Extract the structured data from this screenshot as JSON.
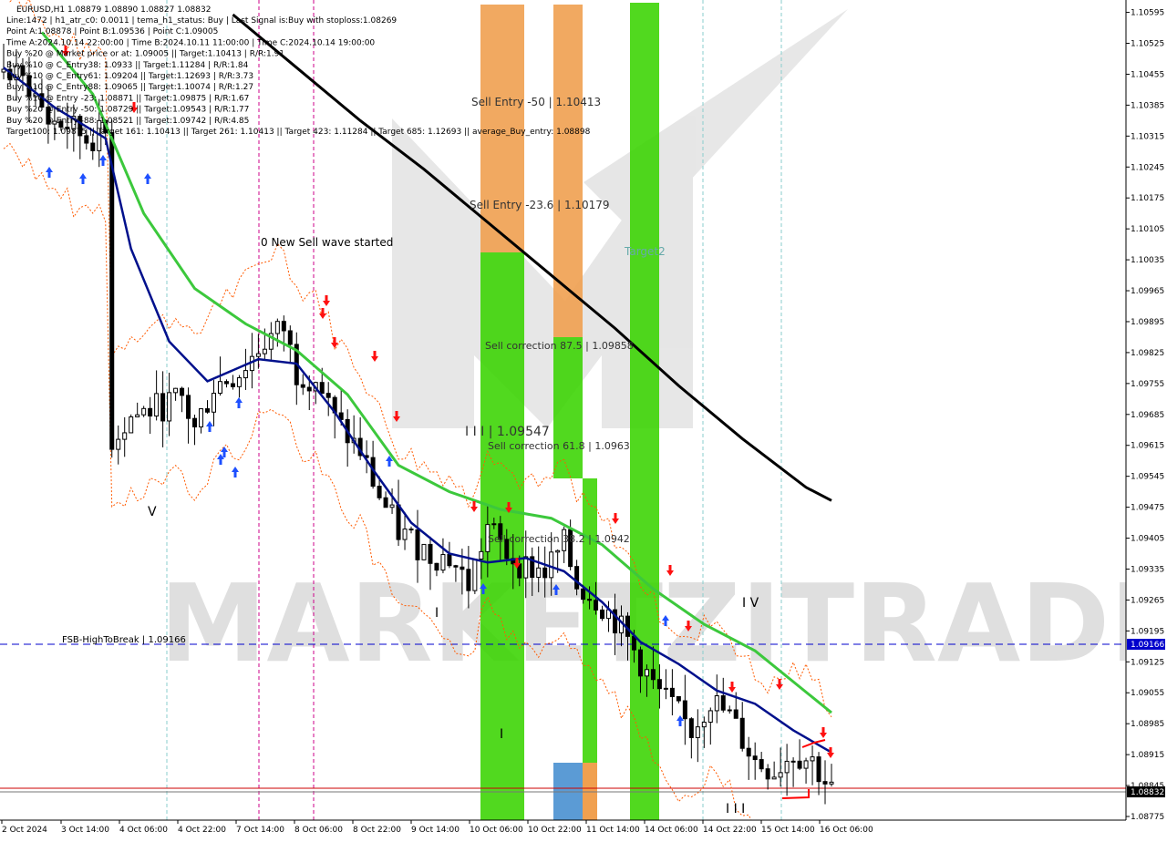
{
  "header": {
    "symbol_line": "EURUSD,H1  1.08879 1.08890 1.08827 1.08832",
    "info_lines": [
      "Line:1472 | h1_atr_c0: 0.0011 | tema_h1_status: Buy | Last Signal is:Buy with stoploss:1.08269",
      "Point A:1.08878 | Point B:1.09536 | Point C:1.09005",
      "Time A:2024.10.14 22:00:00 | Time B:2024.10.11 11:00:00 | Time C:2024.10.14 19:00:00",
      "Buy %20 @ Market price or at: 1.09005 || Target:1.10413 | R/R:1.91",
      "Buy %10 @ C_Entry38: 1.0933 || Target:1.11284 | R/R:1.84",
      "Buy %10 @ C_Entry61: 1.09204 || Target:1.12693 | R/R:3.73",
      "Buy %10 @ C_Entry88: 1.09065 || Target:1.10074 | R/R:1.27",
      "Buy %10 @ Entry -23: 1.08871 || Target:1.09875 | R/R:1.67",
      "Buy %20 @ Entry -50: 1.08729 || Target:1.09543 | R/R:1.77",
      "Buy %20 @ Entry -88: 1.08521 || Target:1.09742 | R/R:4.85",
      "Target100: 1.09875 || Target 161: 1.10413 || Target 261: 1.10413 || Target 423: 1.11284 || Target 685: 1.12693 || average_Buy_entry: 1.08898"
    ]
  },
  "annotations": {
    "sell_entry_50": "Sell Entry -50 | 1.10413",
    "sell_entry_23": "Sell Entry -23.6 | 1.10179",
    "new_sell_wave": "0 New Sell wave started",
    "target2": "Target2",
    "sell_corr_875": "Sell correction 87.5 | 1.09858",
    "sell_corr_618": "Sell correction 61.8 | 1.0963",
    "sell_corr_382": "Sell correction 38.2 | 1.0942",
    "wave_iii_label": "I I I | 1.09547",
    "fsb_label": "FSB-HighToBreak | 1.09166",
    "wave_v": "V",
    "wave_i_a": "I",
    "wave_i_b": "I",
    "wave_iv": "I V",
    "wave_iii_bottom": "I I I",
    "watermark": "MARKETZITRADE"
  },
  "price_tags": {
    "fsb": "1.09166",
    "current": "1.08832"
  },
  "colors": {
    "fsb_line": "#0000cc",
    "current_line": "#cc0000",
    "green_zone": "#39d400",
    "orange_zone": "#f0a050",
    "blue_zone": "#5b9bd5",
    "ema_green": "#3cc83c",
    "ema_navy": "#00108c",
    "long_ma": "#000000",
    "channel": "#ff5a00"
  },
  "chart_data": {
    "type": "candlestick",
    "symbol": "EURUSD,H1",
    "ylim": [
      1.08775,
      1.1059
    ],
    "y_ticks": [
      "1.10595",
      "1.10525",
      "1.10455",
      "1.10385",
      "1.10315",
      "1.10245",
      "1.10175",
      "1.10105",
      "1.10035",
      "1.09965",
      "1.09895",
      "1.09825",
      "1.09755",
      "1.09685",
      "1.09615",
      "1.09545",
      "1.09475",
      "1.09405",
      "1.09335",
      "1.09265",
      "1.09195",
      "1.09125",
      "1.09055",
      "1.08985",
      "1.08915",
      "1.08845",
      "1.08775"
    ],
    "x_ticks": [
      "2 Oct 2024",
      "3 Oct 14:00",
      "4 Oct 06:00",
      "4 Oct 22:00",
      "7 Oct 14:00",
      "8 Oct 06:00",
      "8 Oct 22:00",
      "9 Oct 14:00",
      "10 Oct 06:00",
      "10 Oct 22:00",
      "11 Oct 14:00",
      "14 Oct 06:00",
      "14 Oct 22:00",
      "15 Oct 14:00",
      "16 Oct 06:00"
    ],
    "levels": {
      "sell_entry_50": 1.10413,
      "sell_entry_23_6": 1.10179,
      "sell_correction_87_5": 1.09858,
      "sell_correction_61_8": 1.0963,
      "sell_correction_38_2": 1.0942,
      "wave_iii": 1.09547,
      "fsb_high_to_break": 1.09166,
      "current_price": 1.08832
    },
    "close_path": [
      [
        0,
        1.1046
      ],
      [
        4,
        1.1043
      ],
      [
        7,
        1.1035
      ],
      [
        10,
        1.1034
      ],
      [
        13,
        1.1031
      ],
      [
        16,
        1.1032
      ],
      [
        17,
        1.0963
      ],
      [
        20,
        1.0968
      ],
      [
        24,
        1.097
      ],
      [
        28,
        1.0972
      ],
      [
        30,
        1.0965
      ],
      [
        33,
        1.0975
      ],
      [
        37,
        1.0978
      ],
      [
        41,
        1.0985
      ],
      [
        44,
        1.0988
      ],
      [
        46,
        1.0978
      ],
      [
        49,
        1.0977
      ],
      [
        52,
        1.0967
      ],
      [
        56,
        1.096
      ],
      [
        59,
        1.095
      ],
      [
        62,
        1.0942
      ],
      [
        64,
        1.094
      ],
      [
        67,
        1.0937
      ],
      [
        70,
        1.0936
      ],
      [
        73,
        1.093
      ],
      [
        76,
        1.0943
      ],
      [
        79,
        1.0937
      ],
      [
        82,
        1.0934
      ],
      [
        85,
        1.0933
      ],
      [
        88,
        1.0939
      ],
      [
        90,
        1.093
      ],
      [
        93,
        1.0927
      ],
      [
        96,
        1.0922
      ],
      [
        99,
        1.0915
      ],
      [
        102,
        1.0907
      ],
      [
        105,
        1.0902
      ],
      [
        108,
        1.0897
      ],
      [
        111,
        1.0904
      ],
      [
        114,
        1.09
      ],
      [
        118,
        1.089
      ],
      [
        121,
        1.0888
      ],
      [
        124,
        1.0892
      ],
      [
        127,
        1.089
      ],
      [
        130,
        1.08832
      ]
    ],
    "ema_navy": [
      [
        0,
        1.1047
      ],
      [
        8,
        1.1038
      ],
      [
        16,
        1.1031
      ],
      [
        20,
        1.1006
      ],
      [
        26,
        1.0985
      ],
      [
        32,
        1.0976
      ],
      [
        40,
        1.0981
      ],
      [
        46,
        1.098
      ],
      [
        52,
        1.0969
      ],
      [
        58,
        1.0956
      ],
      [
        64,
        1.0944
      ],
      [
        70,
        1.0937
      ],
      [
        76,
        1.0935
      ],
      [
        82,
        1.0936
      ],
      [
        88,
        1.0933
      ],
      [
        94,
        1.0926
      ],
      [
        100,
        1.0917
      ],
      [
        106,
        1.0912
      ],
      [
        112,
        1.0906
      ],
      [
        118,
        1.0903
      ],
      [
        124,
        1.0897
      ],
      [
        130,
        1.0892
      ]
    ],
    "ema_green": [
      [
        6,
        1.1055
      ],
      [
        14,
        1.1041
      ],
      [
        22,
        1.1014
      ],
      [
        30,
        1.0997
      ],
      [
        38,
        1.0989
      ],
      [
        46,
        1.0983
      ],
      [
        54,
        1.0973
      ],
      [
        62,
        1.0957
      ],
      [
        70,
        1.0951
      ],
      [
        78,
        1.0947
      ],
      [
        86,
        1.0945
      ],
      [
        94,
        1.0939
      ],
      [
        102,
        1.0929
      ],
      [
        110,
        1.0921
      ],
      [
        118,
        1.0915
      ],
      [
        124,
        1.0908
      ],
      [
        130,
        1.0901
      ]
    ],
    "long_ma": [
      [
        36,
        1.1059
      ],
      [
        46,
        1.1047
      ],
      [
        56,
        1.1035
      ],
      [
        66,
        1.1024
      ],
      [
        76,
        1.1012
      ],
      [
        86,
        1.1
      ],
      [
        96,
        1.0988
      ],
      [
        106,
        1.0975
      ],
      [
        116,
        1.0963
      ],
      [
        126,
        1.0952
      ],
      [
        130,
        1.0949
      ]
    ]
  }
}
